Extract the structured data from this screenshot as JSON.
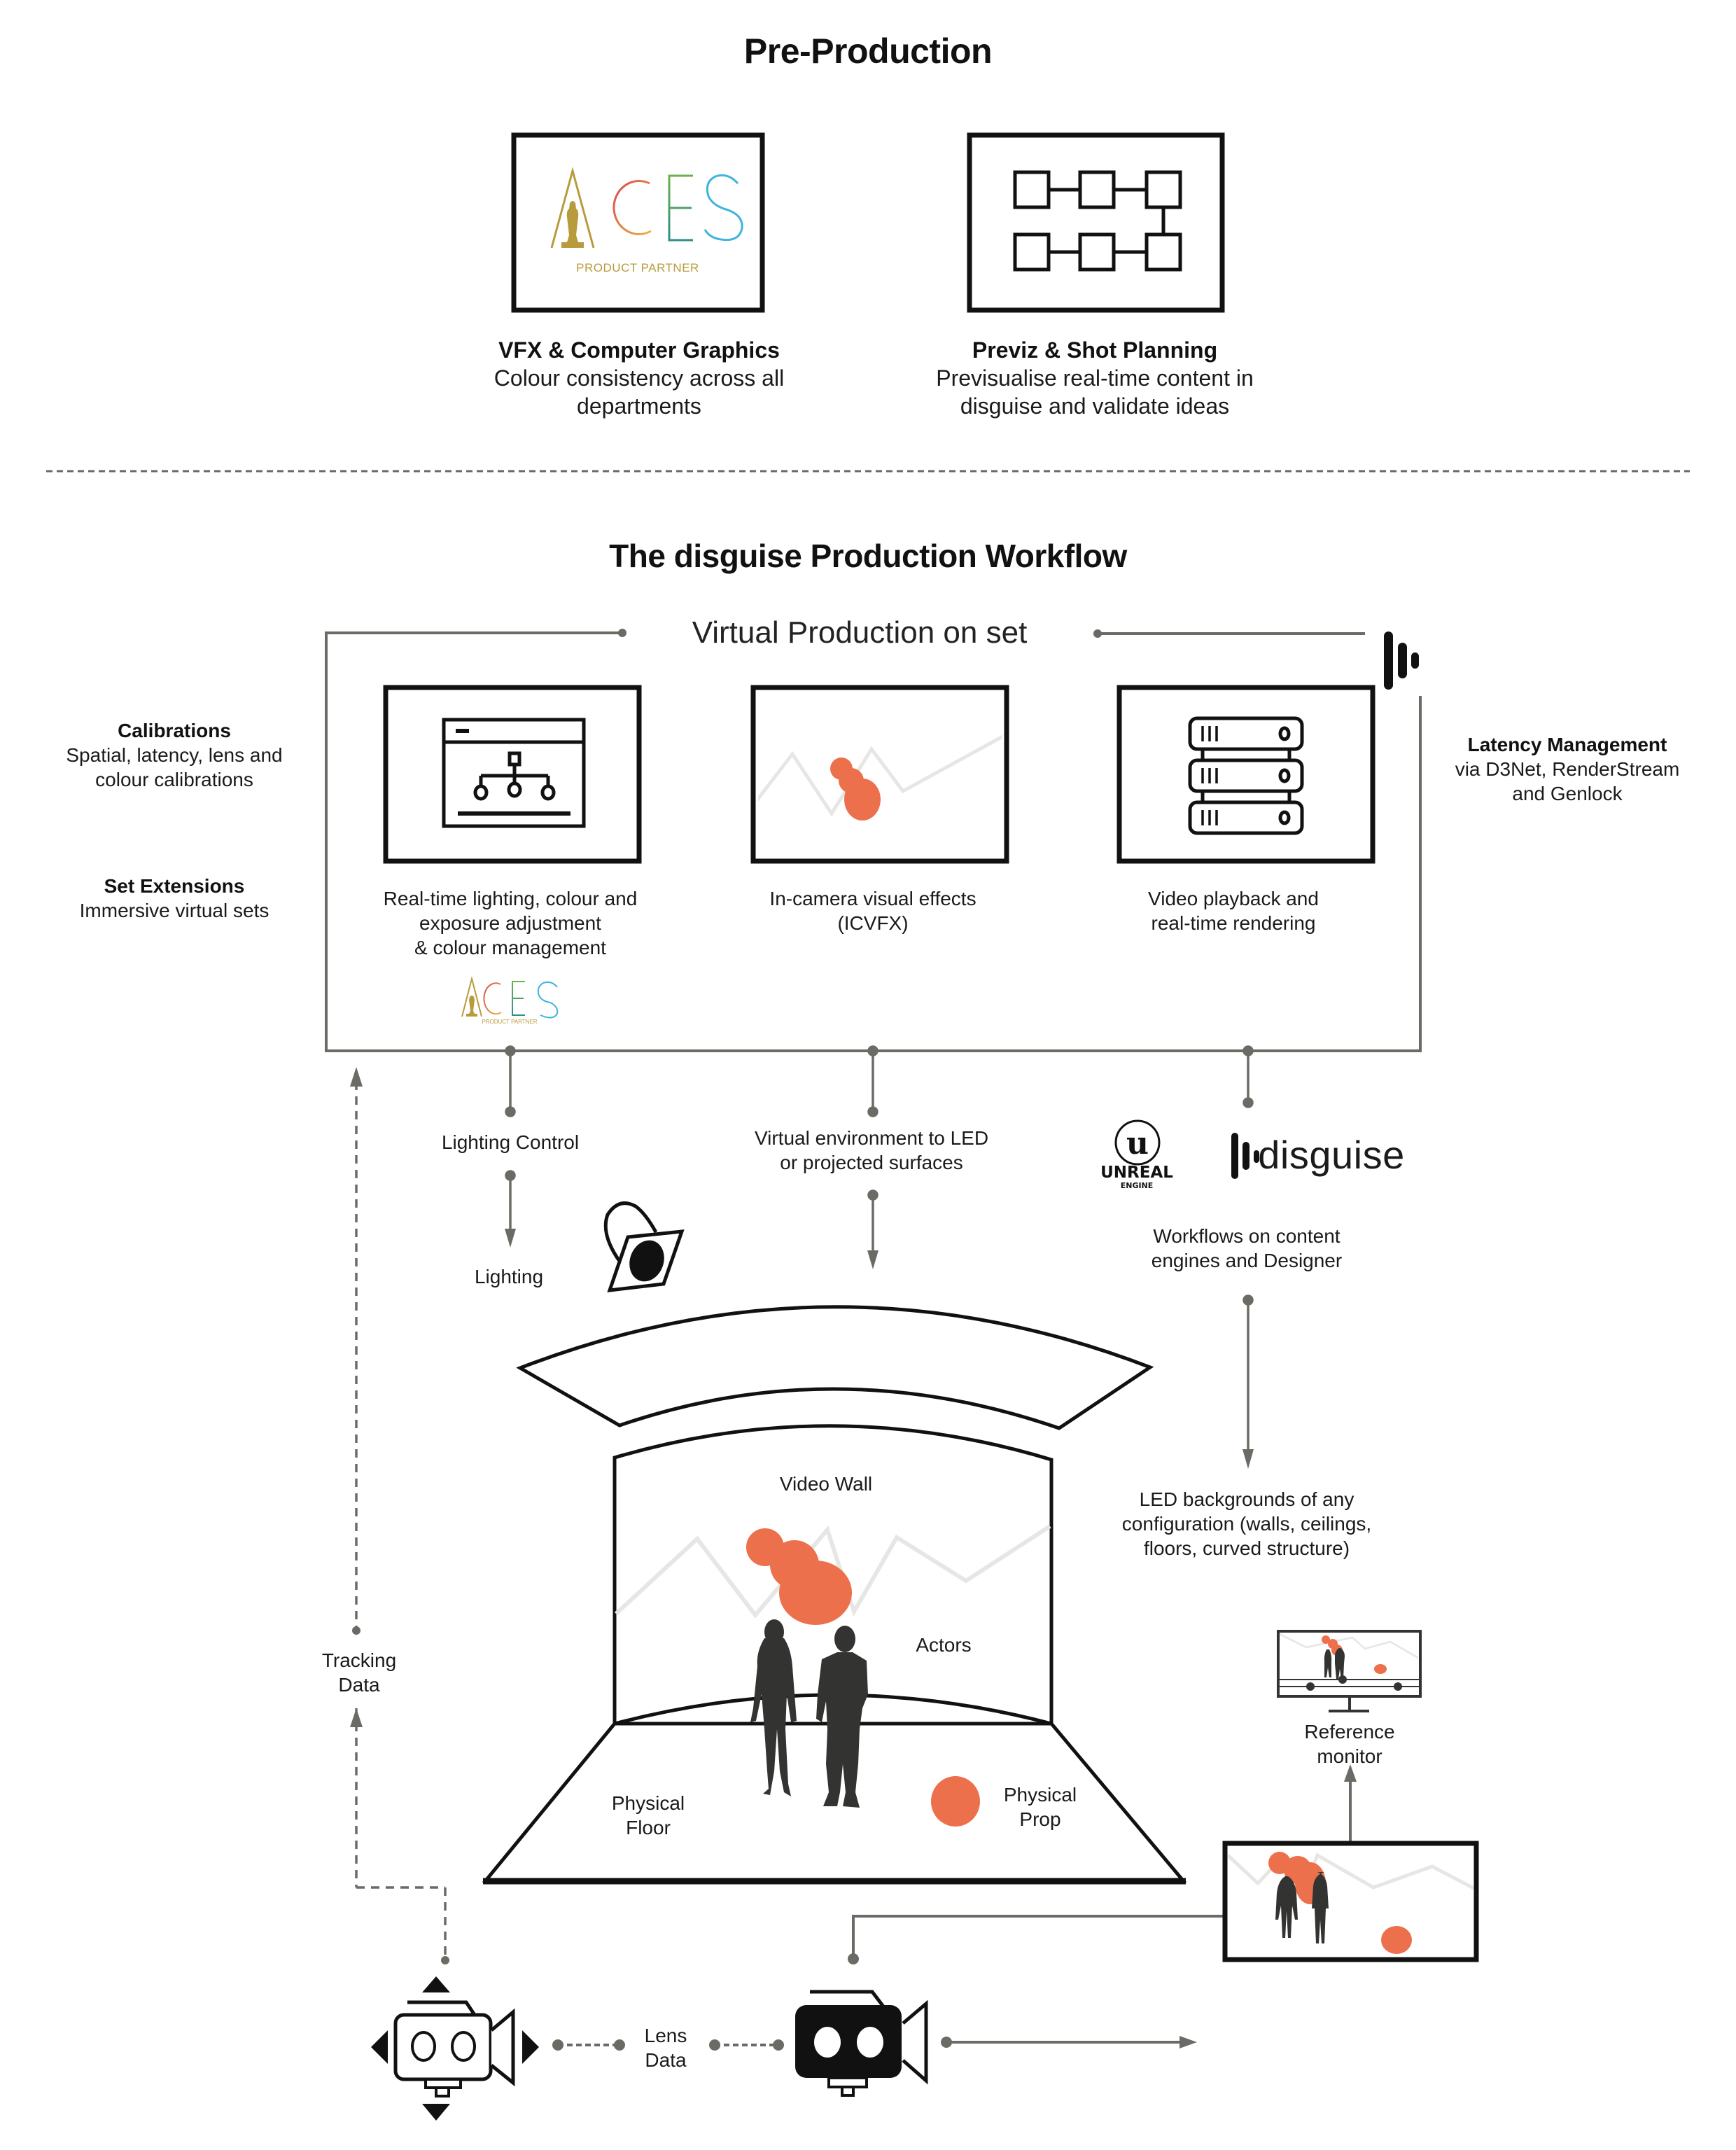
{
  "pre_production": {
    "title": "Pre-Production",
    "cards": [
      {
        "icon": "aces-product-partner-logo",
        "logo_text": "ACES",
        "logo_subtext": "PRODUCT PARTNER",
        "title": "VFX & Computer Graphics",
        "desc_lines": [
          "Colour consistency across all",
          "departments"
        ]
      },
      {
        "icon": "storyboard-flow-icon",
        "title": "Previz & Shot Planning",
        "desc_lines": [
          "Previsualise real-time content in",
          "disguise and validate ideas"
        ]
      }
    ]
  },
  "workflow": {
    "title": "The disguise Production Workflow",
    "frame_title": "Virtual Production on set",
    "side_left": [
      {
        "title": "Calibrations",
        "lines": [
          "Spatial, latency, lens and",
          "colour calibrations"
        ]
      },
      {
        "title": "Set Extensions",
        "lines": [
          "Immersive virtual sets"
        ]
      }
    ],
    "side_right": {
      "title": "Latency Management",
      "lines": [
        "via D3Net, RenderStream",
        "and Genlock"
      ]
    },
    "cards": [
      {
        "icon": "lighting-network-window-icon",
        "lines": [
          "Real-time lighting, colour and",
          "exposure adjustment",
          "& colour management"
        ],
        "badge": "ACES",
        "badge_sub": "PRODUCT PARTNER"
      },
      {
        "icon": "icvfx-scene-icon",
        "lines": [
          "In-camera visual effects",
          "(ICVFX)"
        ]
      },
      {
        "icon": "server-rack-icon",
        "lines": [
          "Video playback and",
          "real-time rendering"
        ]
      }
    ],
    "connectors": {
      "lighting_control": "Lighting Control",
      "lighting": "Lighting",
      "virtual_environment": [
        "Virtual environment to LED",
        "or projected surfaces"
      ],
      "engines": [
        "Workflows on content",
        "engines and Designer"
      ],
      "led_backgrounds": [
        "LED backgrounds of any",
        "configuration (walls, ceilings,",
        "floors, curved structure)"
      ]
    },
    "logos": {
      "unreal": {
        "line1": "UNREAL",
        "line2": "ENGINE"
      },
      "disguise": "disguise"
    },
    "stage": {
      "video_wall": "Video Wall",
      "actors": "Actors",
      "physical_floor": [
        "Physical",
        "Floor"
      ],
      "physical_prop": [
        "Physical",
        "Prop"
      ]
    },
    "tracking_data": [
      "Tracking",
      "Data"
    ],
    "lens_data": [
      "Lens",
      "Data"
    ],
    "reference_monitor": [
      "Reference",
      "monitor"
    ]
  },
  "colors": {
    "accent_orange": "#EC704C",
    "line_gray": "#6b6b66",
    "mountain_gray": "#e6e6e4",
    "silhouette": "#333331",
    "ink": "#111111",
    "aces_gold": "#b89b3c",
    "aces_red": "#d9494f",
    "aces_green": "#6fb04a",
    "aces_blue": "#3fb4dc"
  }
}
